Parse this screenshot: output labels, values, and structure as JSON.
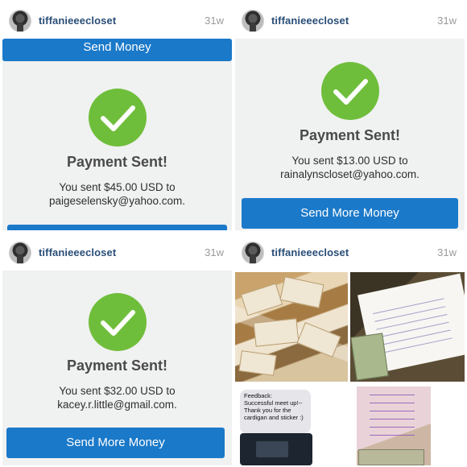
{
  "posts": [
    {
      "username": "tiffanieeecloset",
      "age": "31w",
      "button_top": "Send Money",
      "title": "Payment Sent!",
      "line1": "You sent $45.00 USD to",
      "line2": "paigeselensky@yahoo.com."
    },
    {
      "username": "tiffanieeecloset",
      "age": "31w",
      "title": "Payment Sent!",
      "line1": "You sent $13.00 USD to",
      "line2": "rainalynscloset@yahoo.com.",
      "button_bottom": "Send More Money"
    },
    {
      "username": "tiffanieeecloset",
      "age": "31w",
      "title": "Payment Sent!",
      "line1": "You sent $32.00 USD to",
      "line2": "kacey.r.little@gmail.com.",
      "button_bottom": "Send More Money"
    },
    {
      "username": "tiffanieeecloset",
      "age": "31w",
      "chat_text": [
        "Feedback:",
        "Successful meet up!--",
        "Thank you for the",
        "cardigan and sticker :)"
      ]
    }
  ],
  "colors": {
    "paypal_blue": "#1b79c9",
    "check_green": "#6fbe3b",
    "username_blue": "#2a4e78"
  },
  "icons": [
    "checkmark-icon",
    "avatar"
  ]
}
